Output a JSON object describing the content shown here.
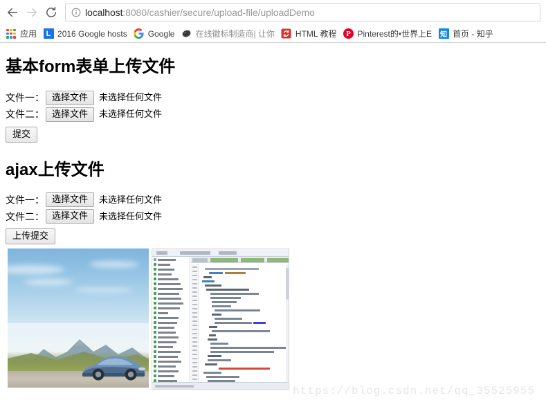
{
  "browser": {
    "nav": {
      "back_icon": "arrow-left-icon",
      "forward_icon": "arrow-right-icon",
      "reload_icon": "reload-icon"
    },
    "omnibox": {
      "info_icon": "info-circle-icon",
      "url_host": "localhost",
      "url_path": ":8080/cashier/secure/upload-file/uploadDemo",
      "url_full": "localhost:8080/cashier/secure/upload-file/uploadDemo"
    },
    "bookmarks": {
      "apps_label": "应用",
      "apps_icon": "apps-grid-icon",
      "items": [
        {
          "label": "2016 Google hosts",
          "icon": "blue-l-icon",
          "icon_text": "L",
          "icon_bg": "#1a73e8",
          "icon_fg": "#ffffff"
        },
        {
          "label": "Google",
          "icon": "google-g-icon",
          "icon_text": "G",
          "icon_bg": "#ffffff",
          "icon_fg": "#4285f4"
        },
        {
          "label": "在线徽标制造商| 让你",
          "icon": "dark-oval-icon",
          "icon_text": "",
          "icon_bg": "#3b3b3b",
          "icon_fg": "#ffffff"
        },
        {
          "label": "HTML 教程",
          "icon": "runoob-icon",
          "icon_text": "S",
          "icon_bg": "#d9322b",
          "icon_fg": "#ffffff"
        },
        {
          "label": "Pinterest的•世界上E",
          "icon": "pinterest-icon",
          "icon_text": "P",
          "icon_bg": "#e60023",
          "icon_fg": "#ffffff"
        },
        {
          "label": "首页 - 知乎",
          "icon": "zhihu-icon",
          "icon_text": "知",
          "icon_bg": "#0f88eb",
          "icon_fg": "#ffffff"
        }
      ]
    }
  },
  "page": {
    "section1": {
      "heading": "基本form表单上传文件",
      "rows": [
        {
          "label": "文件一：",
          "button": "选择文件",
          "status": "未选择任何文件"
        },
        {
          "label": "文件二：",
          "button": "选择文件",
          "status": "未选择任何文件"
        }
      ],
      "submit": "提交"
    },
    "section2": {
      "heading": "ajax上传文件",
      "rows": [
        {
          "label": "文件一：",
          "button": "选择文件",
          "status": "未选择任何文件"
        },
        {
          "label": "文件二：",
          "button": "选择文件",
          "status": "未选择任何文件"
        }
      ],
      "submit": "上传提交"
    },
    "previews": [
      {
        "name": "landscape-car-photo",
        "alt": "蓝色跑车山景照片"
      },
      {
        "name": "code-editor-screenshot",
        "alt": "代码编辑器截图"
      }
    ],
    "watermark": "https://blog.csdn.net/qq_35525955"
  },
  "colors": {
    "accent": "#1a73e8",
    "url_host": "#2b2b2b",
    "url_rest": "#9a9a9a",
    "watermark": "#e6e6e6",
    "heading": "#000000"
  }
}
